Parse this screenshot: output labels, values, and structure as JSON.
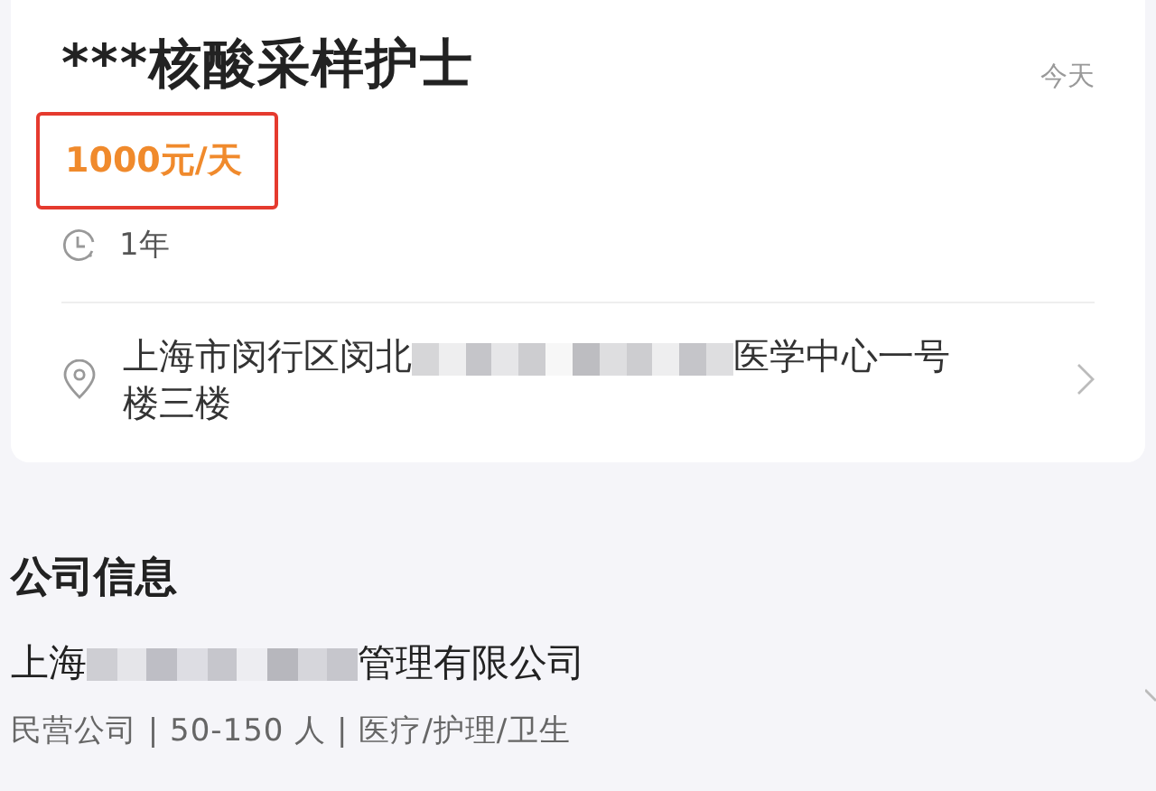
{
  "job": {
    "title": "***核酸采样护士",
    "posted": "今天",
    "salary": "1000元/天",
    "salary_highlighted": true,
    "duration": "1年",
    "address": {
      "before": "上海市闵行区闵北",
      "redacted": true,
      "after": "医学中心一号",
      "next_line": "楼三楼"
    }
  },
  "company": {
    "heading": "公司信息",
    "name": {
      "before": "上海",
      "redacted": true,
      "after": "管理有限公司"
    },
    "meta": "民营公司 | 50-150 人 | 医疗/护理/卫生"
  }
}
